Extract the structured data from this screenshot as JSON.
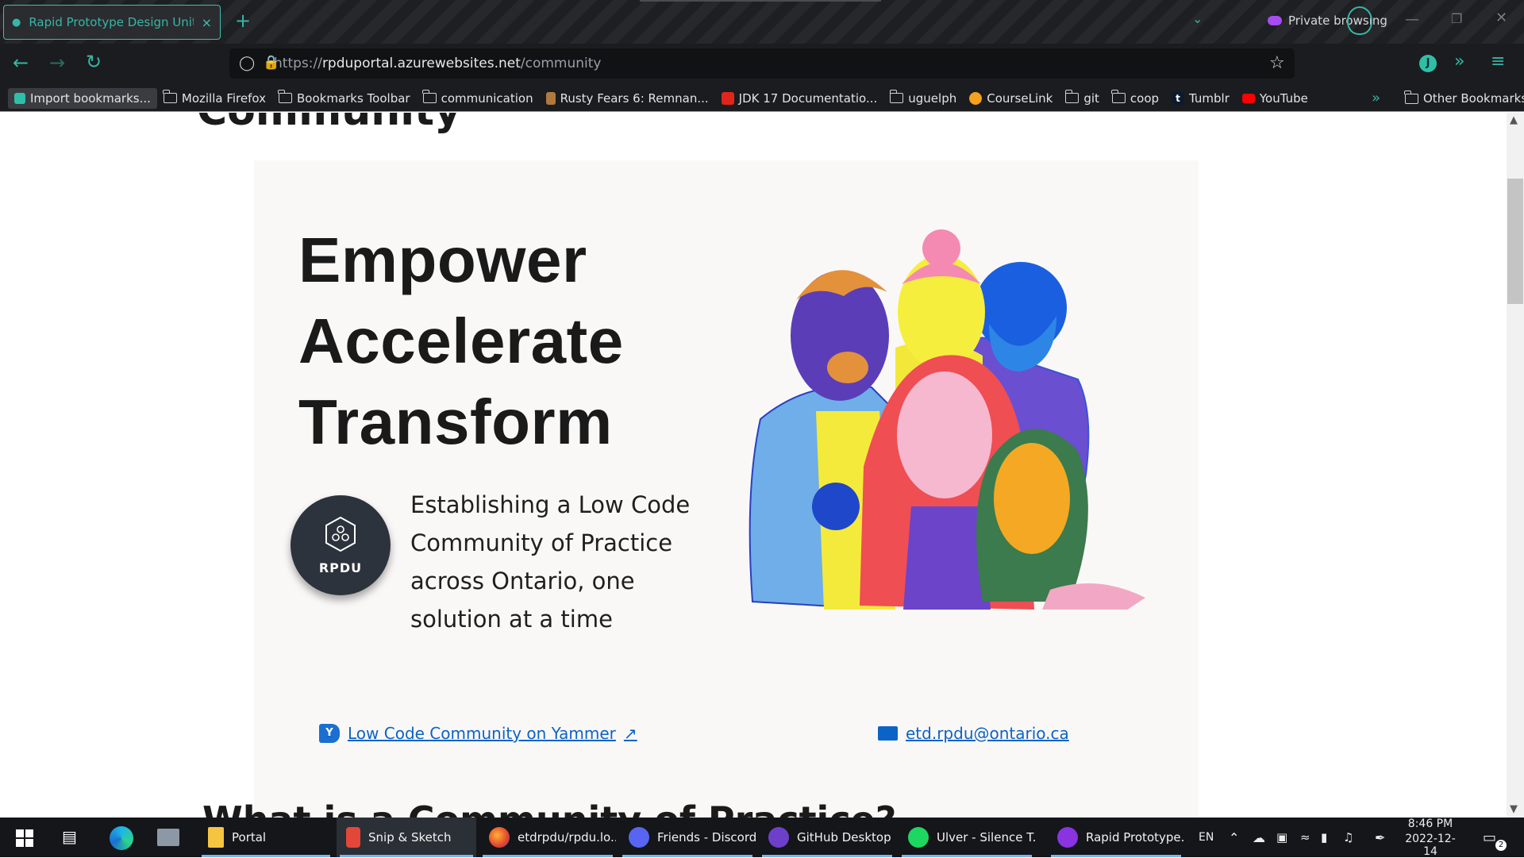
{
  "browser": {
    "tab_title": "Rapid Prototype Design Unit (R",
    "tab_close": "×",
    "new_tab": "+",
    "private_label": "Private browsing",
    "url_prefix": "https://",
    "url_host": "rpduportal.azurewebsites.net",
    "url_path": "/community",
    "profile_initial": "J",
    "bookmarks": [
      {
        "label": "Import bookmarks...",
        "icon": "import-icon"
      },
      {
        "label": "Mozilla Firefox",
        "icon": "folder-icon"
      },
      {
        "label": "Bookmarks Toolbar",
        "icon": "folder-icon"
      },
      {
        "label": "communication",
        "icon": "folder-icon"
      },
      {
        "label": "Rusty Fears 6: Remnan...",
        "icon": "favicon"
      },
      {
        "label": "JDK 17 Documentatio...",
        "icon": "oracle-icon"
      },
      {
        "label": "uguelph",
        "icon": "folder-icon"
      },
      {
        "label": "CourseLink",
        "icon": "courselink-icon"
      },
      {
        "label": "git",
        "icon": "folder-icon"
      },
      {
        "label": "coop",
        "icon": "folder-icon"
      },
      {
        "label": "Tumblr",
        "icon": "tumblr-icon"
      },
      {
        "label": "YouTube",
        "icon": "youtube-icon"
      }
    ],
    "other_bookmarks": "Other Bookmarks"
  },
  "page": {
    "heading_cut": "Community",
    "hero_lines": [
      "Empower",
      "Accelerate",
      "Transform"
    ],
    "logo_label": "RPDU",
    "tagline": "Establishing a Low Code Community of Practice across Ontario, one solution at a time",
    "yammer_link": "Low Code Community on Yammer",
    "email_link": "etd.rpdu@ontario.ca",
    "next_heading": "What is a Community of Practice?"
  },
  "taskbar": {
    "apps": [
      {
        "label": "Portal"
      },
      {
        "label": "Snip & Sketch"
      },
      {
        "label": "etdrpdu/rpdu.lo..."
      },
      {
        "label": "Friends - Discord"
      },
      {
        "label": "GitHub Desktop"
      },
      {
        "label": "Ulver - Silence T..."
      },
      {
        "label": "Rapid Prototype..."
      }
    ],
    "lang": "EN",
    "time": "8:46 PM",
    "date": "2022-12-14",
    "notif_count": "2"
  },
  "colors": {
    "accent": "#36b6a6",
    "link": "#0c63c7",
    "card_bg": "#faf8f7"
  }
}
